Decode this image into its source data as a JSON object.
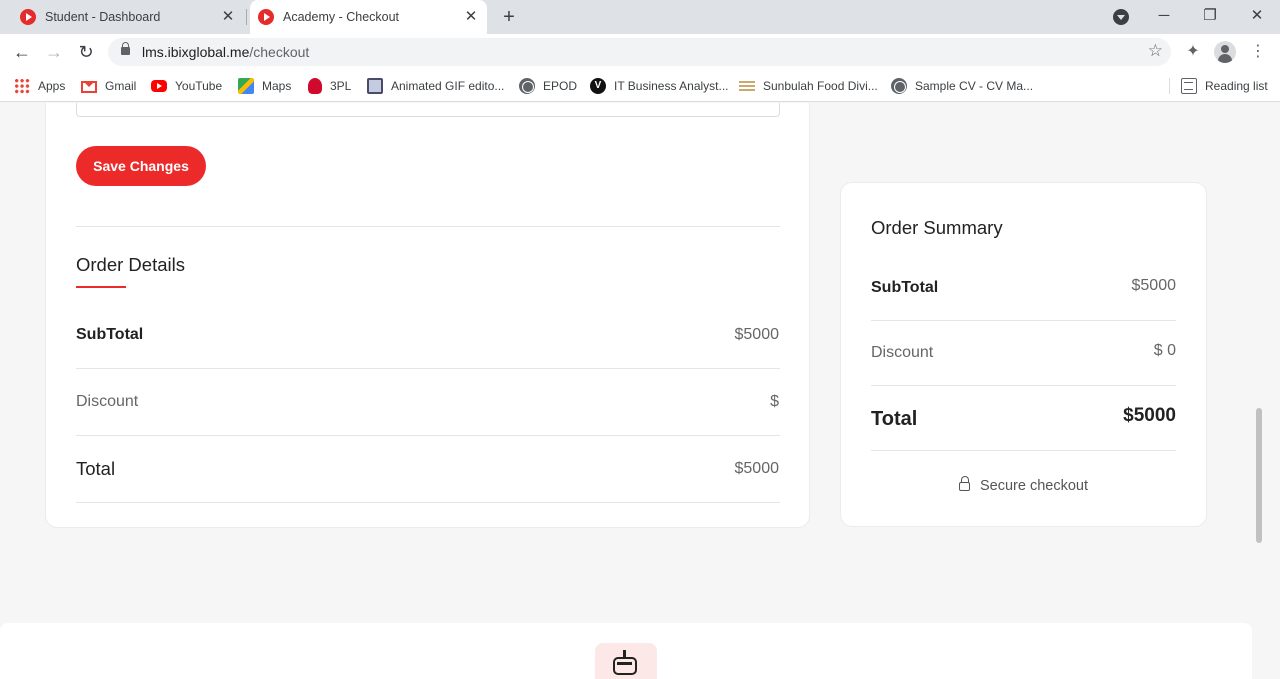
{
  "browser": {
    "tabs": [
      {
        "title": "Student - Dashboard",
        "active": false
      },
      {
        "title": "Academy - Checkout",
        "active": true
      }
    ],
    "url_host": "lms.ibixglobal.me",
    "url_path": "/checkout",
    "bookmarks": [
      {
        "label": "Apps",
        "icon": "apps-grid-icon"
      },
      {
        "label": "Gmail",
        "icon": "gmail-icon"
      },
      {
        "label": "YouTube",
        "icon": "youtube-icon"
      },
      {
        "label": "Maps",
        "icon": "maps-icon"
      },
      {
        "label": "3PL",
        "icon": "huawei-icon"
      },
      {
        "label": "Animated GIF edito...",
        "icon": "gif-editor-icon"
      },
      {
        "label": "EPOD",
        "icon": "globe-icon"
      },
      {
        "label": "IT Business Analyst...",
        "icon": "v-logo-icon"
      },
      {
        "label": "Sunbulah Food Divi...",
        "icon": "sunbulah-icon"
      },
      {
        "label": "Sample CV - CV Ma...",
        "icon": "globe-icon"
      }
    ],
    "reading_list": "Reading list"
  },
  "checkout": {
    "save_button": "Save Changes",
    "order_details": {
      "title": "Order Details",
      "subtotal_label": "SubTotal",
      "subtotal_value": "$5000",
      "discount_label": "Discount",
      "discount_value": "$",
      "total_label": "Total",
      "total_value": "$5000"
    },
    "order_summary": {
      "title": "Order Summary",
      "subtotal_label": "SubTotal",
      "subtotal_value": "$5000",
      "discount_label": "Discount",
      "discount_value": "$ 0",
      "total_label": "Total",
      "total_value": "$5000",
      "secure_label": "Secure checkout"
    }
  },
  "colors": {
    "accent": "#ec2a2a",
    "page_background": "#f6f6f6"
  }
}
